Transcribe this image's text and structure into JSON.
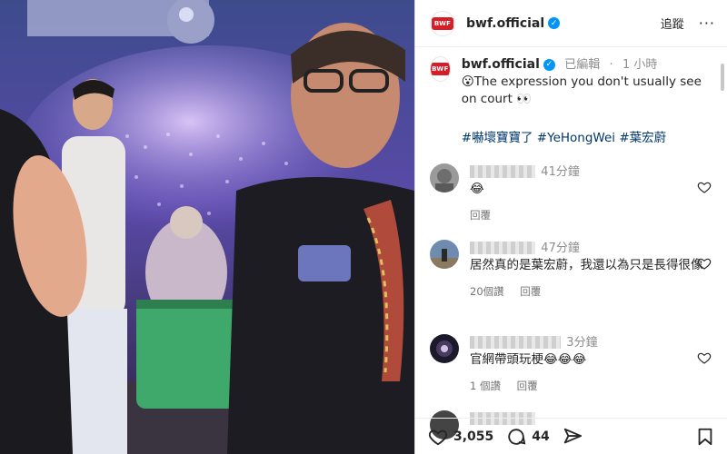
{
  "post": {
    "username": "bwf.official",
    "follow_label": "追蹤",
    "more_label": "···",
    "logo_text": "BWF"
  },
  "caption": {
    "username": "bwf.official",
    "edited": "已編輯",
    "separator": "·",
    "time": "1 小時",
    "text": "😮The expression you don't usually see on court 👀",
    "hashtags": "#嚇壞寶寶了 #YeHongWei #葉宏蔚"
  },
  "comments": [
    {
      "time": "41分鐘",
      "text": "😂",
      "actions": [
        "回覆"
      ]
    },
    {
      "time": "47分鐘",
      "text": "居然真的是葉宏蔚，我還以為只是長得很像",
      "actions": [
        "20個讚",
        "回覆"
      ]
    },
    {
      "time": "3分鐘",
      "text": "官網帶頭玩梗😂😂😂",
      "actions": [
        "1 個讚",
        "回覆"
      ]
    }
  ],
  "action_bar": {
    "likes": "3,055",
    "comments": "44"
  },
  "colors": {
    "brand": "#d71e28",
    "verified": "#0095f6",
    "hashtag": "#00376b",
    "muted": "#8e8e8e"
  },
  "icons": [
    "verified-icon",
    "heart-icon",
    "comment-icon",
    "share-icon",
    "bookmark-icon"
  ]
}
